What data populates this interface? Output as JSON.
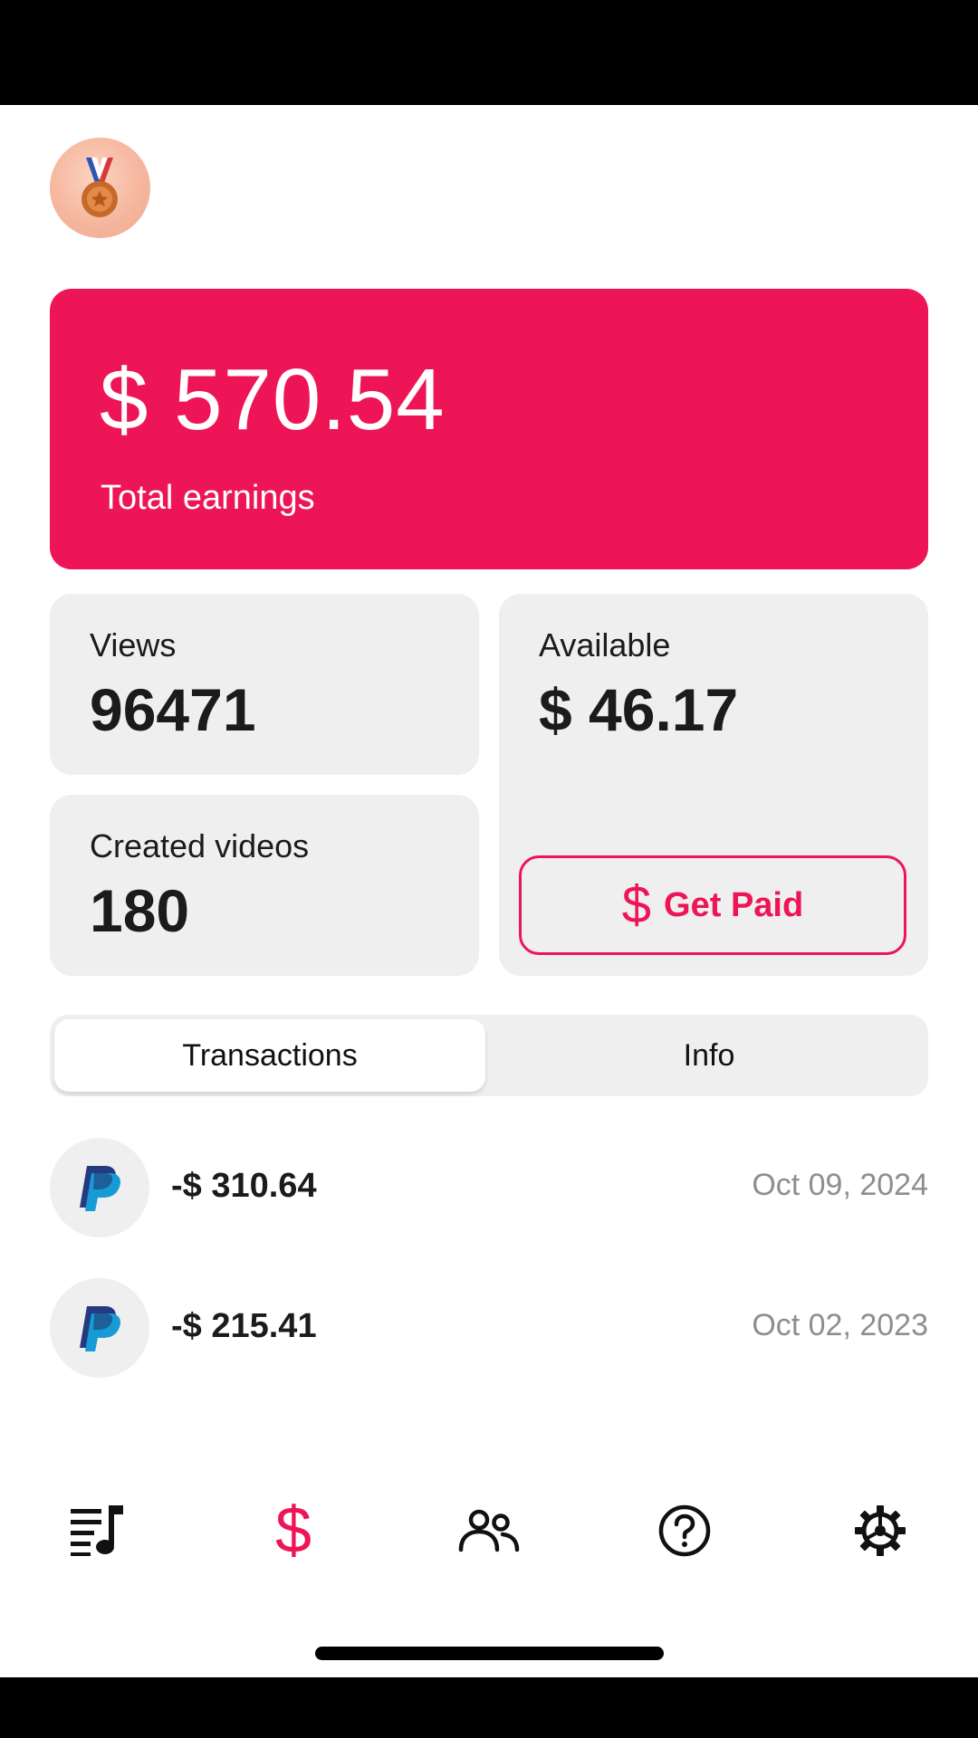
{
  "header": {
    "badge_icon": "bronze-medal-icon"
  },
  "earnings": {
    "amount": "$ 570.54",
    "label": "Total earnings",
    "color": "#ee1557"
  },
  "stats": {
    "views": {
      "label": "Views",
      "value": "96471"
    },
    "videos": {
      "label": "Created videos",
      "value": "180"
    },
    "available": {
      "label": "Available",
      "value": "$ 46.17"
    }
  },
  "get_paid": {
    "icon": "$",
    "label": "Get Paid"
  },
  "tabs": [
    {
      "label": "Transactions",
      "active": true
    },
    {
      "label": "Info",
      "active": false
    }
  ],
  "transactions": [
    {
      "icon": "paypal-icon",
      "amount": "-$ 310.64",
      "date": "Oct 09, 2024"
    },
    {
      "icon": "paypal-icon",
      "amount": "-$ 215.41",
      "date": "Oct 02, 2023"
    }
  ],
  "nav": {
    "items": [
      "playlist-icon",
      "dollar-icon",
      "users-icon",
      "help-icon",
      "settings-icon"
    ],
    "active": "dollar-icon",
    "dollar_glyph": "$"
  }
}
